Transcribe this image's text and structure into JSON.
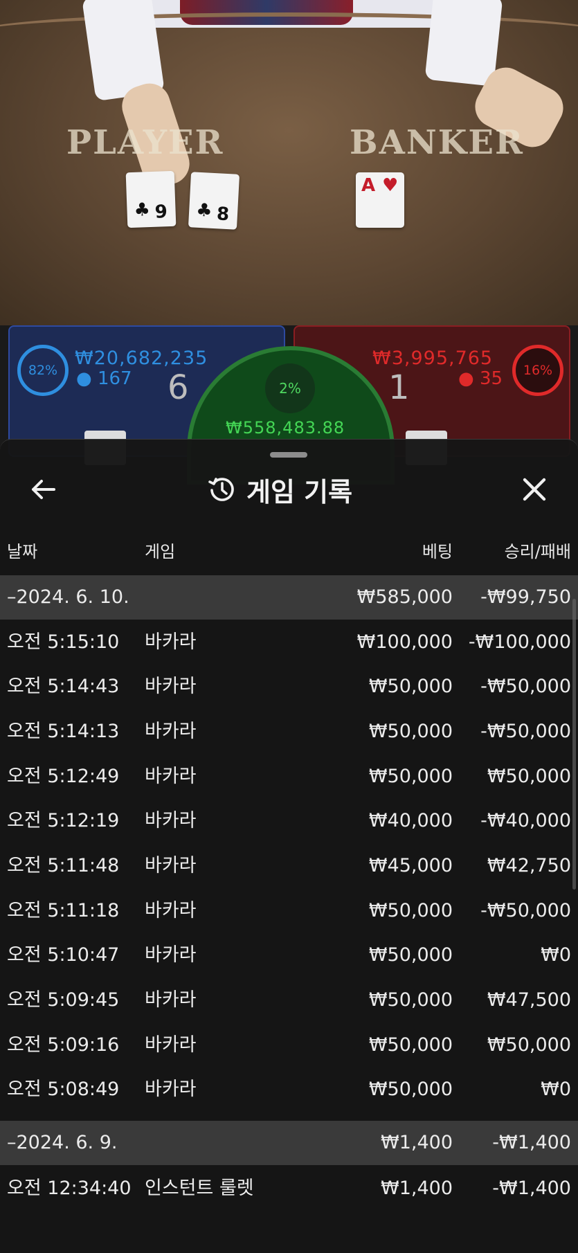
{
  "table": {
    "player_label": "PLAYER",
    "banker_label": "BANKER",
    "player_cards": [
      {
        "rank": "9",
        "suit": "♣",
        "color": "black"
      },
      {
        "rank": "8",
        "suit": "♣",
        "color": "black"
      }
    ],
    "banker_cards": [
      {
        "rank": "A",
        "suit": "♥",
        "color": "red"
      }
    ]
  },
  "bets": {
    "player": {
      "percent": "82%",
      "amount": "₩20,682,235",
      "players": "167",
      "score": "6",
      "color": "#2f8fe0"
    },
    "banker": {
      "percent": "16%",
      "amount": "₩3,995,765",
      "players": "35",
      "score": "1",
      "color": "#e02a2a"
    },
    "tie": {
      "percent": "2%",
      "amount": "₩558,483.88",
      "color": "#3ccf4e"
    }
  },
  "sheet": {
    "title": "게임 기록",
    "columns": {
      "date": "날짜",
      "game": "게임",
      "bet": "베팅",
      "result": "승리/패배"
    },
    "groups": [
      {
        "date": "–2024. 6. 10.",
        "bet_total": "₩585,000",
        "result_total": "-₩99,750",
        "rows": [
          {
            "time": "오전 5:15:10",
            "game": "바카라",
            "bet": "₩100,000",
            "result": "-₩100,000"
          },
          {
            "time": "오전 5:14:43",
            "game": "바카라",
            "bet": "₩50,000",
            "result": "-₩50,000"
          },
          {
            "time": "오전 5:14:13",
            "game": "바카라",
            "bet": "₩50,000",
            "result": "-₩50,000"
          },
          {
            "time": "오전 5:12:49",
            "game": "바카라",
            "bet": "₩50,000",
            "result": "₩50,000"
          },
          {
            "time": "오전 5:12:19",
            "game": "바카라",
            "bet": "₩40,000",
            "result": "-₩40,000"
          },
          {
            "time": "오전 5:11:48",
            "game": "바카라",
            "bet": "₩45,000",
            "result": "₩42,750"
          },
          {
            "time": "오전 5:11:18",
            "game": "바카라",
            "bet": "₩50,000",
            "result": "-₩50,000"
          },
          {
            "time": "오전 5:10:47",
            "game": "바카라",
            "bet": "₩50,000",
            "result": "₩0"
          },
          {
            "time": "오전 5:09:45",
            "game": "바카라",
            "bet": "₩50,000",
            "result": "₩47,500"
          },
          {
            "time": "오전 5:09:16",
            "game": "바카라",
            "bet": "₩50,000",
            "result": "₩50,000"
          },
          {
            "time": "오전 5:08:49",
            "game": "바카라",
            "bet": "₩50,000",
            "result": "₩0"
          }
        ]
      },
      {
        "date": "–2024. 6. 9.",
        "bet_total": "₩1,400",
        "result_total": "-₩1,400",
        "rows": [
          {
            "time": "오전 12:34:40",
            "game": "인스턴트 룰렛",
            "bet": "₩1,400",
            "result": "-₩1,400"
          }
        ]
      }
    ]
  }
}
